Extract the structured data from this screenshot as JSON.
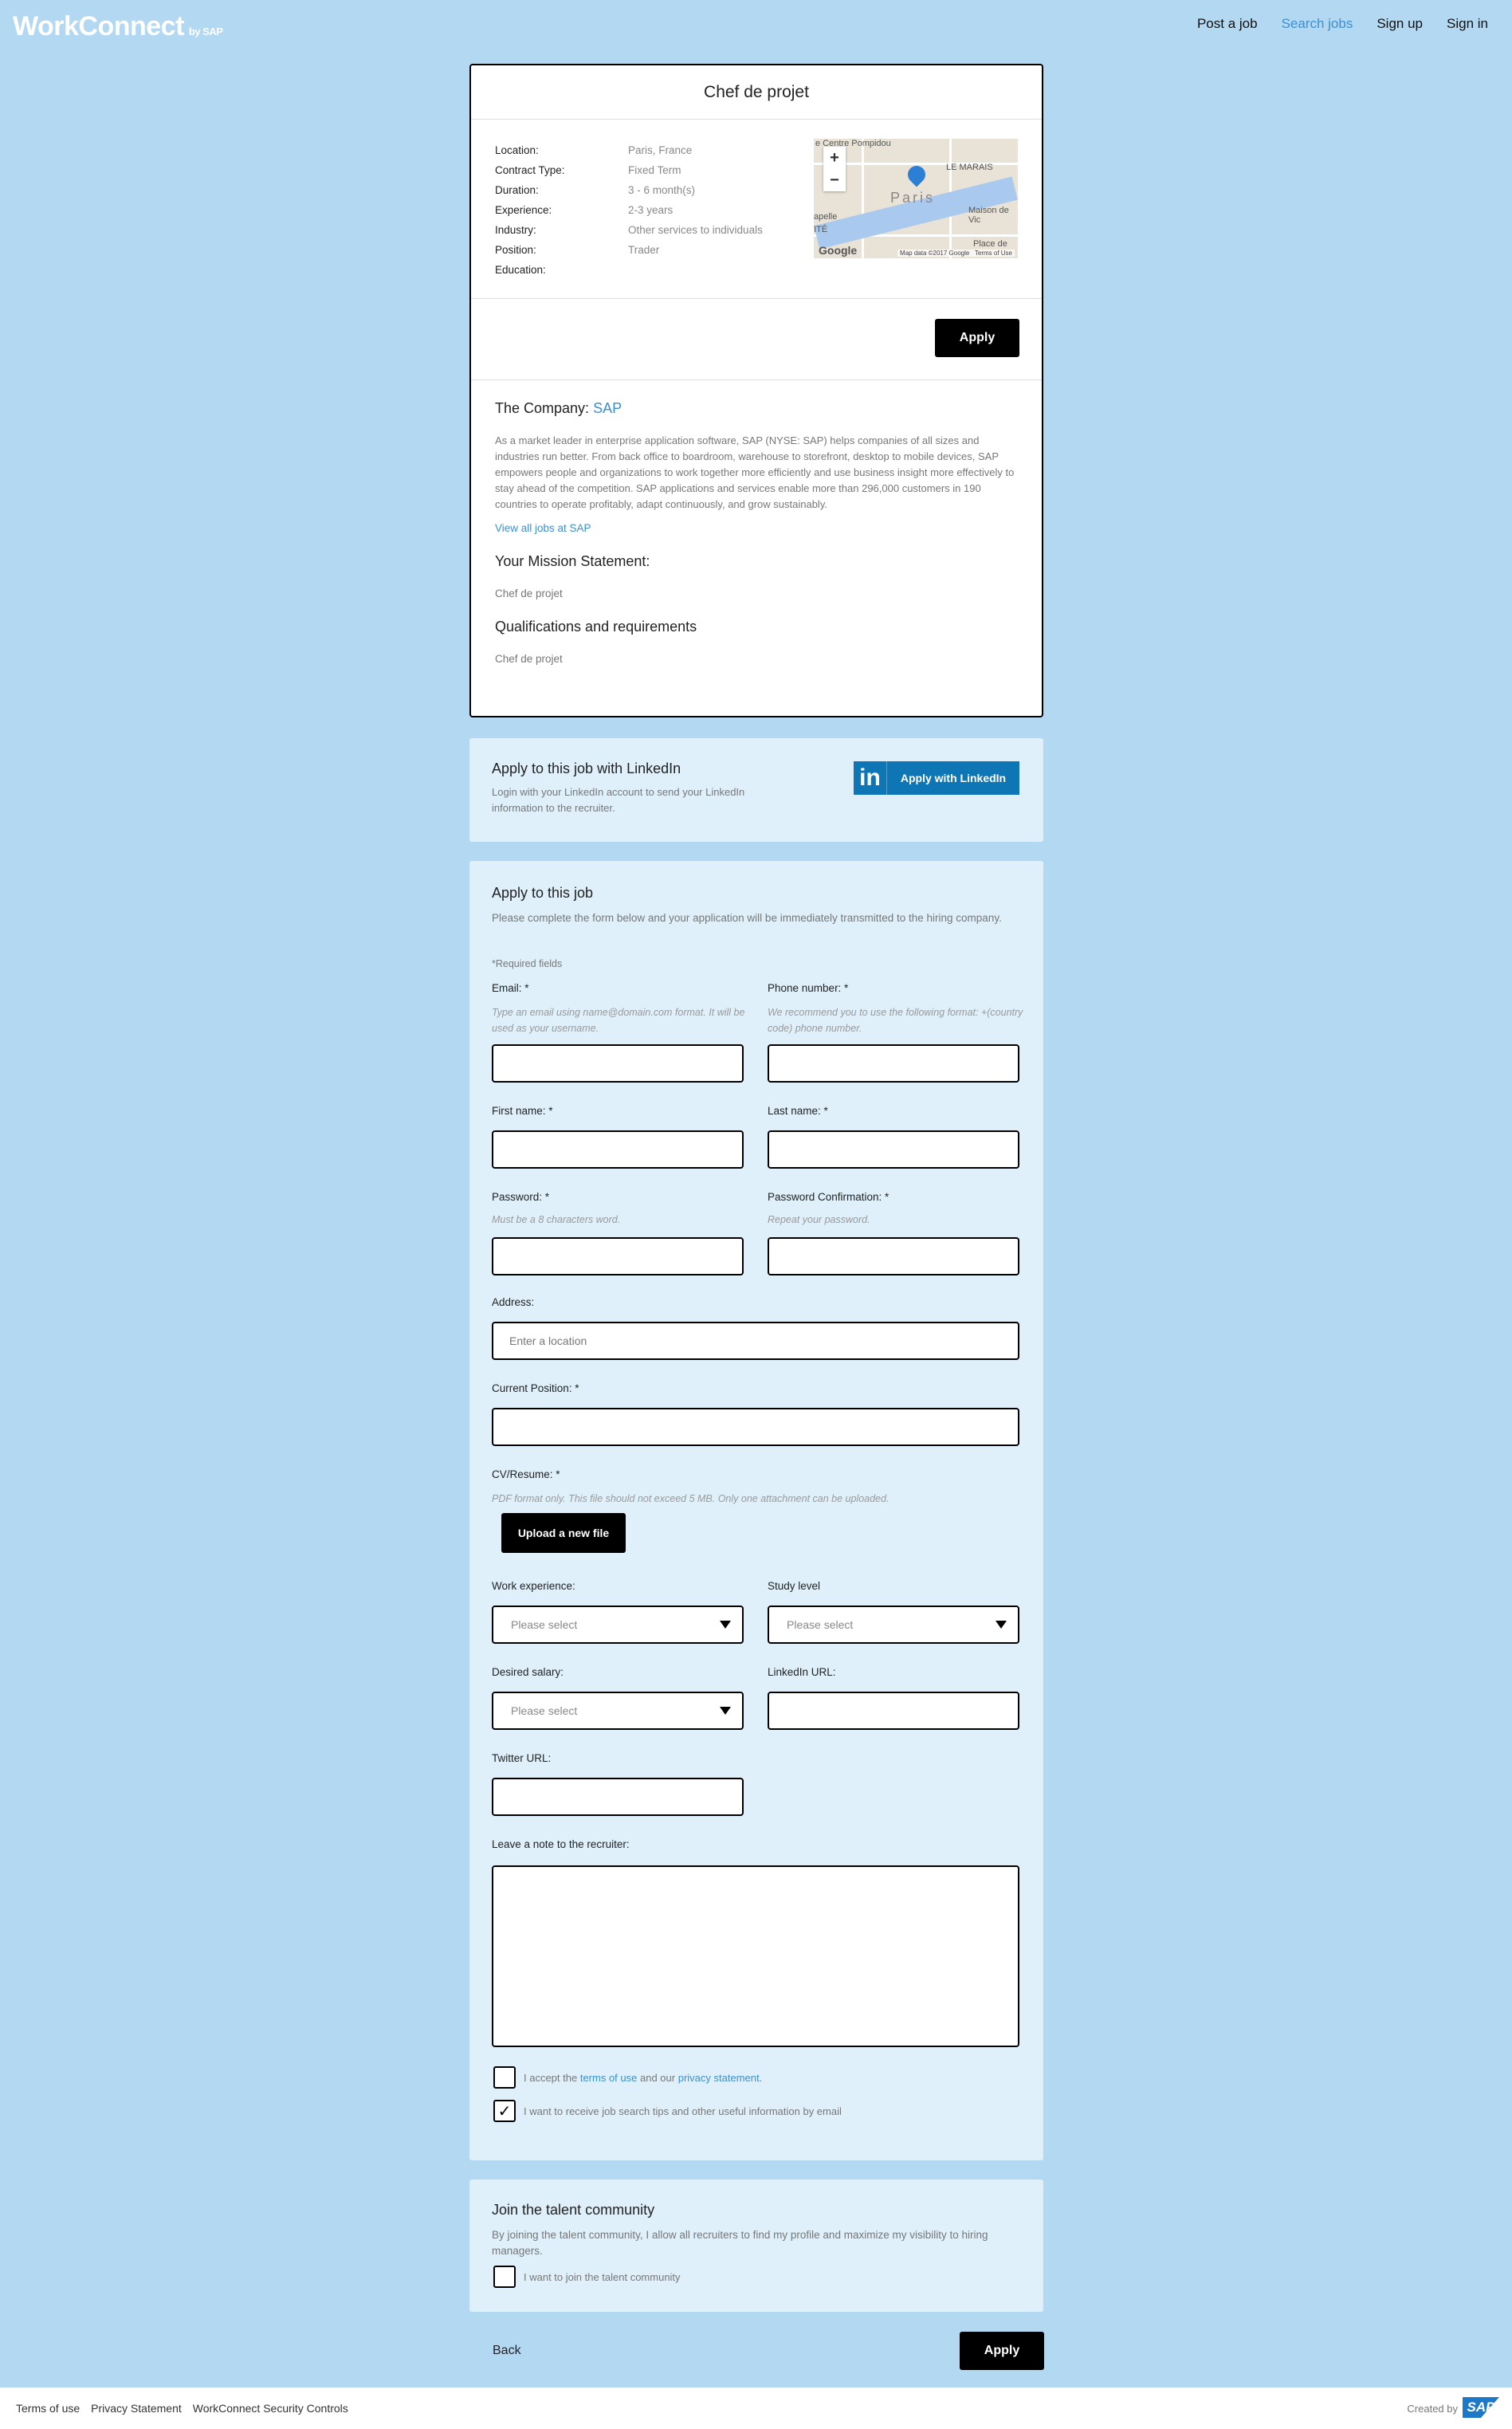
{
  "header": {
    "logo": "WorkConnect",
    "logo_by": "by SAP",
    "nav": [
      {
        "label": "Post a job",
        "active": false
      },
      {
        "label": "Search jobs",
        "active": true
      },
      {
        "label": "Sign up",
        "active": false
      },
      {
        "label": "Sign in",
        "active": false
      }
    ]
  },
  "job": {
    "title": "Chef de projet",
    "details": [
      {
        "label": "Location:",
        "value": "Paris, France"
      },
      {
        "label": "Contract Type:",
        "value": "Fixed Term"
      },
      {
        "label": "Duration:",
        "value": "3 - 6 month(s)"
      },
      {
        "label": "Experience:",
        "value": "2-3 years"
      },
      {
        "label": "Industry:",
        "value": "Other services to individuals"
      },
      {
        "label": "Position:",
        "value": "Trader"
      },
      {
        "label": "Education:",
        "value": ""
      }
    ],
    "map": {
      "labels": [
        "e Centre Pompidou",
        "LE MARAIS",
        "Paris",
        "Maison de Vic",
        "apelle",
        "Place de",
        "ITÉ"
      ],
      "google": "Google",
      "copyright": "Map data ©2017 Google",
      "terms": "Terms of Use"
    },
    "apply_label": "Apply",
    "company_heading": "The Company:",
    "company_name": "SAP",
    "company_description": "As a market leader in enterprise application software, SAP (NYSE: SAP) helps companies of all sizes and industries run better. From back office to boardroom, warehouse to storefront, desktop to mobile devices, SAP empowers people and organizations to work together more efficiently and use business insight more effectively to stay ahead of the competition. SAP applications and services enable more than 296,000 customers in 190 countries to operate profitably, adapt continuously, and grow sustainably.",
    "view_all_jobs": "View all jobs at SAP",
    "mission_heading": "Your Mission Statement:",
    "mission_text": "Chef de projet",
    "qualifications_heading": "Qualifications and requirements",
    "qualifications_text": "Chef de projet"
  },
  "linkedin": {
    "heading": "Apply to this job with LinkedIn",
    "text": "Login with your LinkedIn account to send your LinkedIn information to the recruiter.",
    "button_icon": "in",
    "button_label": "Apply with LinkedIn"
  },
  "form": {
    "heading": "Apply to this job",
    "intro": "Please complete the form below and your application will be immediately transmitted to the hiring company.",
    "required_note": "*Required fields",
    "email_label": "Email: *",
    "email_hint": "Type an email using name@domain.com format. It will be used as your username.",
    "phone_label": "Phone number: *",
    "phone_hint": "We recommend you to use the following format: +(country code) phone number.",
    "first_name_label": "First name: *",
    "last_name_label": "Last name: *",
    "password_label": "Password: *",
    "password_hint": "Must be a 8 characters word.",
    "password_confirm_label": "Password Confirmation: *",
    "password_confirm_hint": "Repeat your password.",
    "address_label": "Address:",
    "address_placeholder": "Enter a location",
    "current_position_label": "Current Position: *",
    "cv_label": "CV/Resume: *",
    "cv_hint": "PDF format only. This file should not exceed 5 MB. Only one attachment can be uploaded.",
    "upload_label": "Upload a new file",
    "work_experience_label": "Work experience:",
    "work_experience_value": "Please select",
    "study_level_label": "Study level",
    "study_level_value": "Please select",
    "desired_salary_label": "Desired salary:",
    "desired_salary_value": "Please select",
    "linkedin_url_label": "LinkedIn URL:",
    "twitter_url_label": "Twitter URL:",
    "note_label": "Leave a note to the recruiter:",
    "terms_prefix": "I accept the",
    "terms_link": "terms of use",
    "terms_middle": "and our",
    "privacy_link": "privacy statement",
    "terms_suffix": ".",
    "terms_checked": false,
    "tips_label": "I want to receive job search tips and other useful information by email",
    "tips_checked": true,
    "check_mark": "✓"
  },
  "talent": {
    "heading": "Join the talent community",
    "text": "By joining the talent community, I allow all recruiters to find my profile and maximize my visibility to hiring managers.",
    "checkbox_label": "I want to join the talent community",
    "checked": false
  },
  "actions": {
    "back": "Back",
    "apply": "Apply"
  },
  "footer": {
    "links": [
      "Terms of use",
      "Privacy Statement",
      "WorkConnect Security Controls"
    ],
    "created_by": "Created by",
    "sap_logo": "SAP"
  },
  "colors": {
    "background": "#b3d8f2",
    "panel": "#dff0fb",
    "accent": "#3b8fd4",
    "linkedin": "#0e76b4"
  }
}
